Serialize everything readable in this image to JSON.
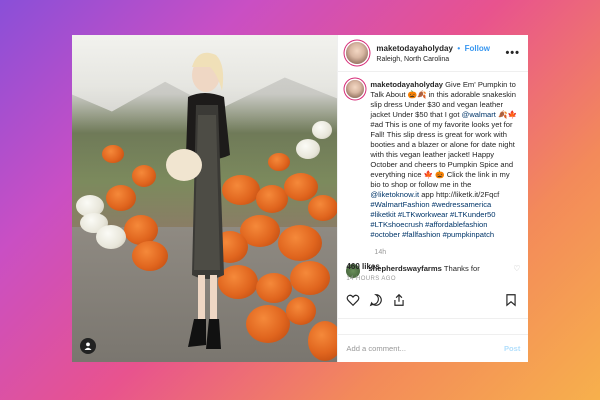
{
  "post": {
    "username": "maketodayaholyday",
    "follow_label": "Follow",
    "separator": "•",
    "location": "Raleigh, North Carolina",
    "more_label": "•••",
    "caption_intro": "Give Em' Pumpkin to Talk About 🎃🍂 in this adorable snakeskin slip dress Under $30 and vegan leather jacket Under $50 that I got ",
    "caption_mention": "@walmart",
    "caption_mid": " 🍂🍁 #ad This is one of my favorite looks yet for Fall! This slip dress is great for work with booties and a blazer or alone for date night with this vegan leather jacket! Happy October and cheers to Pumpkin Spice and everything nice 🍁 🎃 Click the link in my bio to shop or follow me in the ",
    "caption_mention2": "@liketoknow.it",
    "caption_end": " app http://liketk.it/2Fqcf ",
    "caption_tags": "#WalmartFashion #wedressamerica #liketkit #LTKworkwear #LTKunder50 #LTKshoecrush #affordablefashion #october #fallfashion #pumpkinpatch",
    "caption_age": "14h",
    "comment_user": "shepherdswayfarms",
    "comment_text": "Thanks for",
    "likes": "460 likes",
    "time_ago": "14 HOURS AGO",
    "add_comment_placeholder": "Add a comment...",
    "post_button": "Post"
  },
  "icons": {
    "heart": "heart-icon",
    "comment": "comment-icon",
    "share": "share-icon",
    "bookmark": "bookmark-icon",
    "user_tag": "user-tag-icon",
    "more": "more-icon"
  },
  "colors": {
    "follow_blue": "#3897f0",
    "link_navy": "#003569",
    "post_disabled": "#b2dffc",
    "background_gradient_start": "#8a4fd8",
    "background_gradient_end": "#f7b04c"
  }
}
